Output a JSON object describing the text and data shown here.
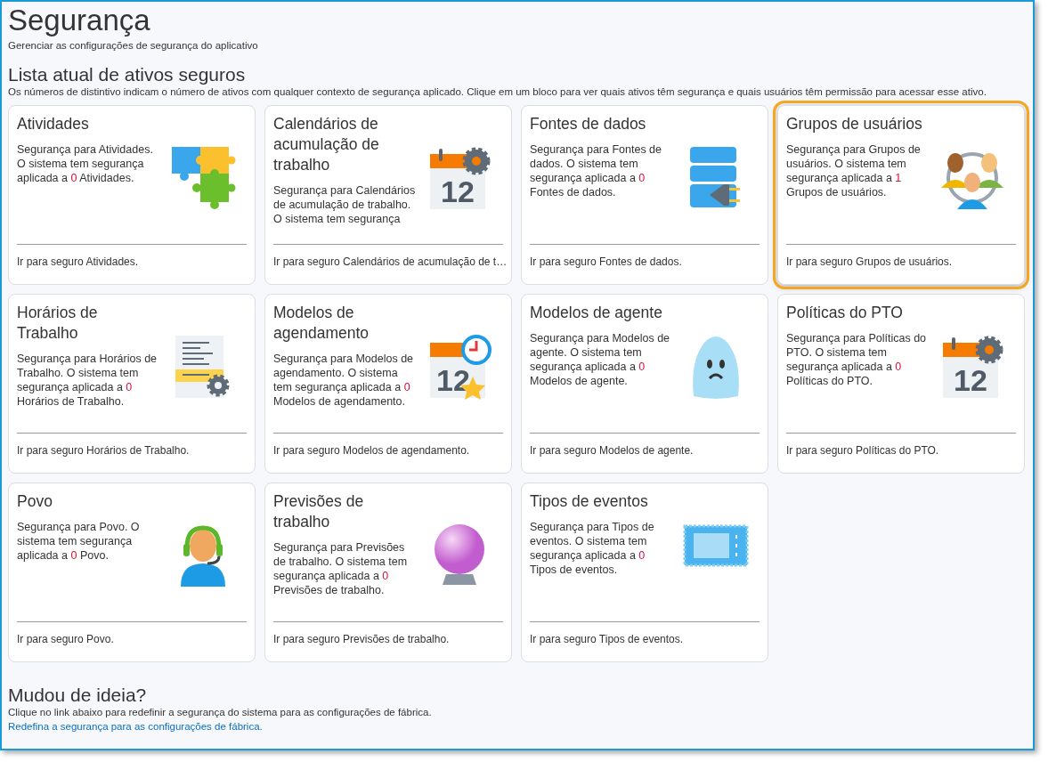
{
  "page": {
    "title": "Segurança",
    "subtitle": "Gerenciar as configurações de segurança do aplicativo"
  },
  "assets": {
    "heading": "Lista atual de ativos seguros",
    "intro": "Os números de distintivo indicam o número de ativos com qualquer contexto de segurança aplicado. Clique em um bloco para ver quais ativos têm segurança e quais usuários têm permissão para acessar esse ativo.",
    "cards": [
      {
        "title": "Atividades",
        "description": "Segurança para Atividades.  O sistema tem segurança aplicada a",
        "count": "0",
        "description_end": "Atividades.",
        "link": "Ir para seguro Atividades.",
        "selected": false
      },
      {
        "title": "Calendários de acumulação de trabalho",
        "description": "Segurança para Calendários de acumulação de trabalho.  O sistema tem segurança",
        "link": "Ir para seguro Calendários de acumulação de t…",
        "icon_label": "12",
        "selected": false
      },
      {
        "title": "Fontes de dados",
        "description": "Segurança para Fontes de dados.  O sistema tem segurança aplicada a",
        "count": "0",
        "description_end": "Fontes de dados.",
        "link": "Ir para seguro Fontes de dados.",
        "selected": false
      },
      {
        "title": "Grupos de usuários",
        "description": "Segurança para Grupos de usuários.  O sistema tem segurança aplicada a",
        "count": "1",
        "description_end": "Grupos de usuários.",
        "link": "Ir para seguro Grupos de usuários.",
        "selected": true
      },
      {
        "title": "Horários de Trabalho",
        "description": "Segurança para Horários de Trabalho.  O sistema tem segurança aplicada a",
        "count": "0",
        "description_end": "Horários de Trabalho.",
        "link": "Ir para seguro Horários de Trabalho.",
        "selected": false
      },
      {
        "title": "Modelos de agendamento",
        "description": "Segurança para Modelos de agendamento.  O sistema tem segurança aplicada a",
        "count": "0",
        "description_end": "Modelos de agendamento.",
        "link": "Ir para seguro Modelos de agendamento.",
        "icon_label": "12",
        "selected": false
      },
      {
        "title": "Modelos de agente",
        "description": "Segurança para Modelos de agente.  O sistema tem segurança aplicada a",
        "count": "0",
        "description_end": "Modelos de agente.",
        "link": "Ir para seguro Modelos de agente.",
        "selected": false
      },
      {
        "title": "Políticas do PTO",
        "description": "Segurança para Políticas do PTO.  O sistema tem segurança aplicada a",
        "count": "0",
        "description_end": "Políticas do PTO.",
        "link": "Ir para seguro Políticas do PTO.",
        "icon_label": "12",
        "selected": false
      },
      {
        "title": "Povo",
        "description": "Segurança para Povo.  O sistema tem segurança aplicada a",
        "count": "0",
        "description_end": "Povo.",
        "link": "Ir para seguro Povo.",
        "selected": false
      },
      {
        "title": "Previsões de trabalho",
        "description": "Segurança para Previsões de trabalho.  O sistema tem segurança aplicada a",
        "count": "0",
        "description_end": "Previsões de trabalho.",
        "link": "Ir para seguro Previsões de trabalho.",
        "selected": false
      },
      {
        "title": "Tipos de eventos",
        "description": "Segurança para Tipos de eventos.  O sistema tem segurança aplicada a",
        "count": "0",
        "description_end": "Tipos de eventos.",
        "link": "Ir para seguro Tipos de eventos.",
        "selected": false
      }
    ]
  },
  "reset": {
    "heading": "Mudou de ideia?",
    "text": "Clique no link abaixo para redefinir a segurança do sistema para as configurações de fábrica.",
    "link": "Redefina a segurança para as configurações de fábrica."
  }
}
